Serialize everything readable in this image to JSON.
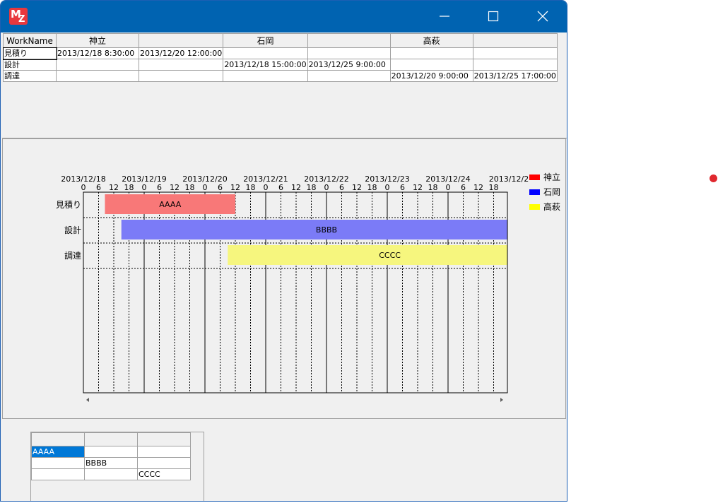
{
  "top_table": {
    "headers": [
      "WorkName",
      "神立",
      "",
      "石岡",
      "",
      "高萩",
      ""
    ],
    "rows": [
      [
        "見積り",
        "2013/12/18 8:30:00",
        "2013/12/20 12:00:00",
        "",
        "",
        "",
        ""
      ],
      [
        "設計",
        "",
        "",
        "2013/12/18 15:00:00",
        "2013/12/25 9:00:00",
        "",
        ""
      ],
      [
        "調達",
        "",
        "",
        "",
        "",
        "2013/12/20 9:00:00",
        "2013/12/25 17:00:00"
      ]
    ]
  },
  "chart_data": {
    "type": "gantt",
    "dates": [
      "2013/12/18",
      "2013/12/19",
      "2013/12/20",
      "2013/12/21",
      "2013/12/22",
      "2013/12/23",
      "2013/12/24",
      "2013/12/2"
    ],
    "hour_ticks": [
      "0",
      "6",
      "12",
      "18"
    ],
    "rows": [
      "見積り",
      "設計",
      "調達"
    ],
    "tasks": [
      {
        "row": "見積り",
        "label": "AAAA",
        "start": "2013/12/18 8:30",
        "end": "2013/12/20 12:00",
        "series": "神立"
      },
      {
        "row": "設計",
        "label": "BBBB",
        "start": "2013/12/18 15:00",
        "end": "2013/12/25 9:00",
        "series": "石岡"
      },
      {
        "row": "調達",
        "label": "CCCC",
        "start": "2013/12/20 9:00",
        "end": "2013/12/25 17:00",
        "series": "高萩"
      }
    ],
    "legend": [
      {
        "name": "神立",
        "color": "#ff0000"
      },
      {
        "name": "石岡",
        "color": "#0000ff"
      },
      {
        "name": "高萩",
        "color": "#ffff00"
      }
    ],
    "bar_colors": {
      "神立": "#f87878",
      "石岡": "#7b7bf7",
      "高萩": "#f6f67e"
    },
    "legend_placement": "right"
  },
  "bottom_table": {
    "rows": [
      [
        "AAAA",
        "",
        ""
      ],
      [
        "",
        "BBBB",
        ""
      ],
      [
        "",
        "",
        "CCCC"
      ]
    ]
  },
  "icons": {
    "app": "mz-app-icon",
    "minimize": "minimize-icon",
    "maximize": "maximize-icon",
    "close": "close-icon",
    "indicator": "red-dot"
  }
}
